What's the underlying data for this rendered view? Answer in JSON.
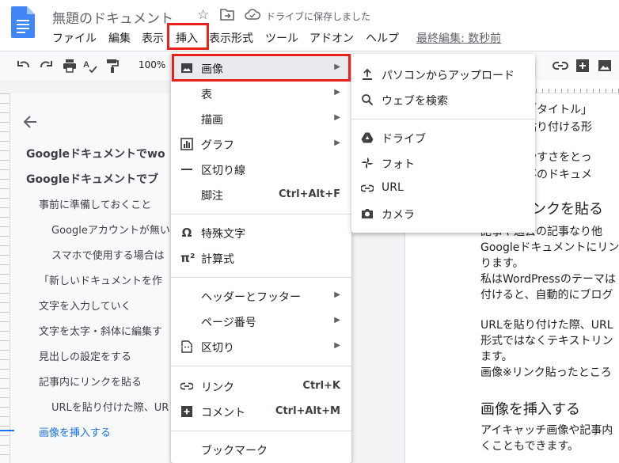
{
  "header": {
    "doc_title": "無題のドキュメント",
    "save_status": "ドライブに保存しました",
    "last_edit": "最終編集: 数秒前",
    "menu": [
      "ファイル",
      "編集",
      "表示",
      "挿入",
      "表示形式",
      "ツール",
      "アドオン",
      "ヘルプ"
    ]
  },
  "toolbar": {
    "zoom": "100%"
  },
  "outline": {
    "items": [
      "Googleドキュメントでwo",
      "Googleドキュメントでブ",
      "事前に準備しておくこと",
      "Googleアカウントが無い",
      "スマホで使用する場合は",
      "「新しいドキュメントを作",
      "文字を入力していく",
      "文字を太字・斜体に編集す",
      "見出しの設定をする",
      "記事内にリンクを貼る",
      "URLを貼り付けた際、UR",
      "画像を挿入する"
    ]
  },
  "page": {
    "lines": [
      "では「タイトル」",
      "ぞれ貼り付ける形",
      "、見やすさをとっ",
      "の記事のドキュメ",
      "にリンクを貼る",
      "記事や過去の記事なり他",
      "Googleドキュメントにリン",
      "ります。",
      "私はWordPressのテーマは",
      "付けると、自動的にブログ",
      "URLを貼り付けた際、URL",
      "形式ではなくテキストリン",
      "ます。",
      "画像※リンク貼ったところ",
      "画像を挿入する",
      "アイキャッチ画像や記事内",
      "くこともできます。"
    ]
  },
  "insert_menu": {
    "items": [
      {
        "label": "画像",
        "shortcut": "",
        "icon": "image-icon"
      },
      {
        "label": "表",
        "shortcut": "",
        "icon": ""
      },
      {
        "label": "描画",
        "shortcut": "",
        "icon": ""
      },
      {
        "label": "グラフ",
        "shortcut": "",
        "icon": "chart-icon"
      },
      {
        "label": "区切り線",
        "shortcut": "",
        "icon": "horizontal-line-icon"
      },
      {
        "label": "脚注",
        "shortcut": "Ctrl+Alt+F",
        "icon": ""
      },
      {
        "label": "特殊文字",
        "shortcut": "",
        "icon": "omega-icon"
      },
      {
        "label": "計算式",
        "shortcut": "",
        "icon": "pi-icon"
      },
      {
        "label": "ヘッダーとフッター",
        "shortcut": "",
        "icon": ""
      },
      {
        "label": "ページ番号",
        "shortcut": "",
        "icon": ""
      },
      {
        "label": "区切り",
        "shortcut": "",
        "icon": "break-icon"
      },
      {
        "label": "リンク",
        "shortcut": "Ctrl+K",
        "icon": "link-icon"
      },
      {
        "label": "コメント",
        "shortcut": "Ctrl+Alt+M",
        "icon": "comment-icon"
      },
      {
        "label": "ブックマーク",
        "shortcut": "",
        "icon": ""
      }
    ]
  },
  "image_submenu": {
    "items": [
      {
        "label": "パソコンからアップロード",
        "icon": "upload-icon"
      },
      {
        "label": "ウェブを検索",
        "icon": "search-icon"
      },
      {
        "label": "ドライブ",
        "icon": "drive-icon"
      },
      {
        "label": "フォト",
        "icon": "photos-icon"
      },
      {
        "label": "URL",
        "icon": "link-icon"
      },
      {
        "label": "カメラ",
        "icon": "camera-icon"
      }
    ]
  },
  "colors": {
    "highlight_box": "#e8211a",
    "accent": "#1a73e8",
    "docs_blue": "#4285f4"
  }
}
